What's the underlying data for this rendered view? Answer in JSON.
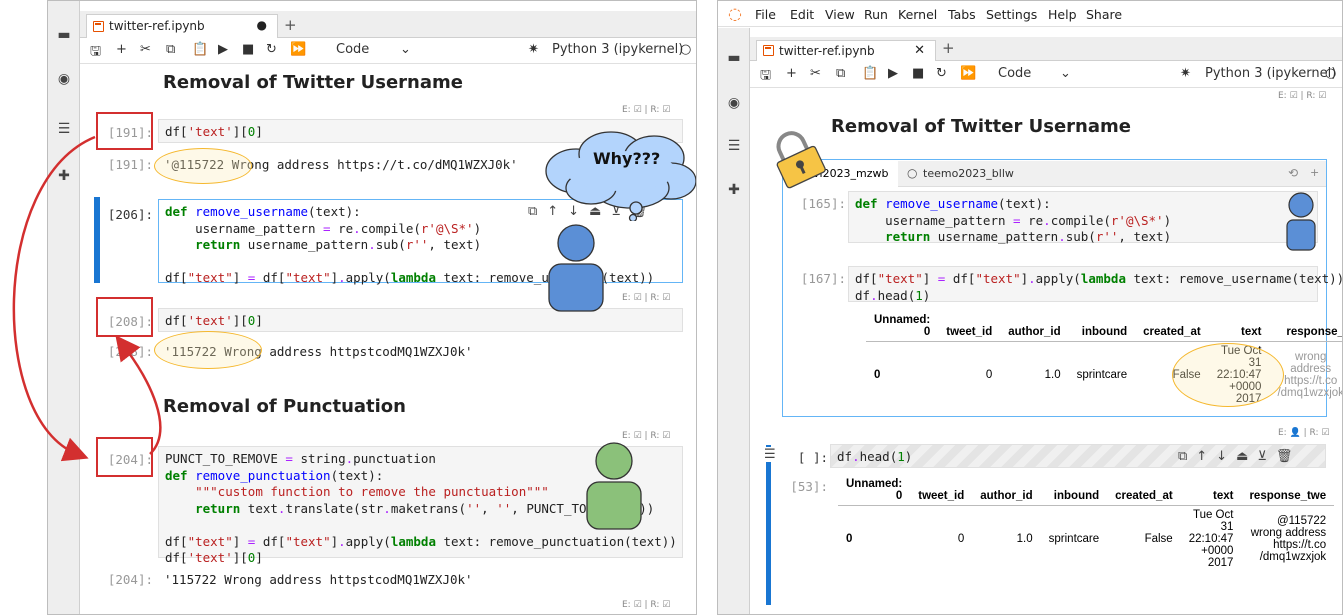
{
  "left": {
    "tab_title": "twitter-ref.ipynb",
    "kernel": "Python 3 (ipykernel)",
    "cell_type": "Code",
    "heading1": "Removal of Twitter Username",
    "heading2": "Removal of Punctuation",
    "meta_label": "E: ☑ | R: ☑",
    "cells": {
      "c191_in": "[191]:",
      "c191_out_prompt": "[191]:",
      "c191_out": "'@115722 Wrong address https://t.co/dMQ1WZXJ0k'",
      "c206_in": "[206]:",
      "c208_in": "[208]:",
      "c208_out_prompt": "[208]:",
      "c208_out": "'115722 Wrong address httpstcodMQ1WZXJ0k'",
      "c204_in": "[204]:",
      "c204_out_prompt": "[204]:",
      "c204_out": "'115722 Wrong address httpstcodMQ1WZXJ0k'"
    },
    "cloud_text": "Why???"
  },
  "right": {
    "menu": [
      "File",
      "Edit",
      "View",
      "Run",
      "Kernel",
      "Tabs",
      "Settings",
      "Help",
      "Share"
    ],
    "tab_title": "twitter-ref.ipynb",
    "kernel": "Python 3 (ipykernel)",
    "cell_type": "Code",
    "heading1": "Removal of Twitter Username",
    "user_tab1": "vi2023_mzwb",
    "user_tab2": "teemo2023_bllw",
    "meta_label": "E: ☑ | R: ☑",
    "meta_label2": "E: 👤 | R: ☑",
    "p165": "[165]:",
    "p167": "[167]:",
    "pempty": "[ ]:",
    "p53": "[53]:",
    "table1": {
      "headers": [
        "Unnamed: 0",
        "tweet_id",
        "author_id",
        "inbound",
        "created_at",
        "text",
        "response_"
      ],
      "row": [
        "0",
        "0",
        "1.0",
        "sprintcare",
        "False",
        "Tue Oct 31 22:10:47 +0000 2017",
        "wrong address https://t.co /dmq1wzxjok"
      ]
    },
    "table2": {
      "headers": [
        "Unnamed: 0",
        "tweet_id",
        "author_id",
        "inbound",
        "created_at",
        "text",
        "response_twe"
      ],
      "row": [
        "0",
        "0",
        "1.0",
        "sprintcare",
        "False",
        "Tue Oct 31 22:10:47 +0000 2017",
        "@115722 wrong address https://t.co /dmq1wzxjok"
      ]
    }
  }
}
